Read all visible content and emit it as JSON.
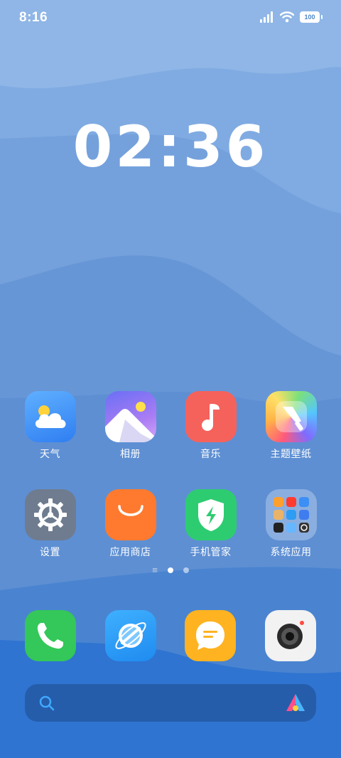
{
  "status_bar": {
    "time": "8:16",
    "battery": "100"
  },
  "clock": {
    "time": "02:36"
  },
  "apps": [
    {
      "name": "weather",
      "label": "天气"
    },
    {
      "name": "gallery",
      "label": "相册"
    },
    {
      "name": "music",
      "label": "音乐"
    },
    {
      "name": "theme",
      "label": "主题壁纸"
    },
    {
      "name": "settings",
      "label": "设置"
    },
    {
      "name": "app-store",
      "label": "应用商店"
    },
    {
      "name": "phone-manager",
      "label": "手机管家"
    },
    {
      "name": "system-apps",
      "label": "系统应用"
    }
  ],
  "page_indicator": {
    "active": 1,
    "total": 2
  },
  "dock": [
    "phone",
    "browser",
    "messages",
    "camera"
  ],
  "colors": {
    "weather": "#3d8ff5",
    "music": "#f5625c",
    "settings": "#6f7c8f",
    "app_store": "#ff7a2e",
    "phone_manager": "#2ecc71",
    "phone": "#34c759",
    "browser": "#2f9cf4",
    "messages": "#ffb320"
  }
}
